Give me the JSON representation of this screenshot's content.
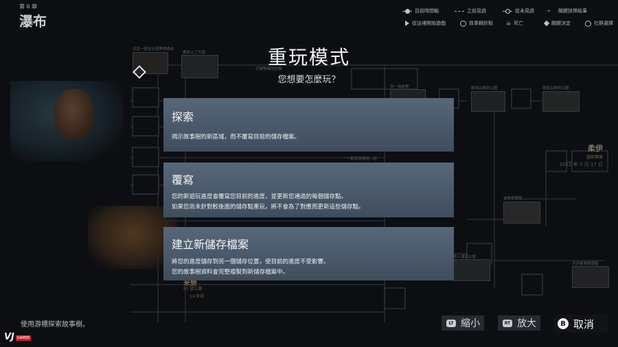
{
  "chapter": {
    "number": "第 6 章",
    "title": "瀑布"
  },
  "legend": [
    {
      "icon": "line-icon",
      "label": "目前時間軸"
    },
    {
      "icon": "dashed-line-icon",
      "label": "之前見過"
    },
    {
      "icon": "hollow-dot-icon",
      "label": "從未見過"
    },
    {
      "icon": "arrows-icon",
      "label": "關鍵抉擇結果"
    },
    {
      "icon": "play-icon",
      "label": "從這裡開始遊戲"
    },
    {
      "icon": "branch-icon",
      "label": "故事轉折點"
    },
    {
      "icon": "skull-icon",
      "label": "死亡"
    },
    {
      "icon": "key-decision-icon",
      "label": "關鍵決定"
    },
    {
      "icon": "community-icon",
      "label": "社群選擇"
    }
  ],
  "character": {
    "name": "柔伊",
    "role": "當前專案",
    "date": "2012 年 3 月 17 日"
  },
  "character2": {
    "name": "米勞",
    "line1": "83 號公路",
    "line2": "14 年前"
  },
  "tree_labels": {
    "t1": "泛克一家在分家夢想森布",
    "t2": "柔伊上了大學",
    "t3": "打破慣風的記錄",
    "t4": "另一場昂夢",
    "t5": "戰場古殿的公窟",
    "t6": "搜尋古殿的公窟",
    "t7": "一起到洞邊過…近",
    "t8": "被警察跟蹤",
    "t9": "他人漂流公窟",
    "t10": "杰伊被警察跟蹤"
  },
  "modal": {
    "title": "重玩模式",
    "subtitle": "您想要怎麼玩？",
    "options": [
      {
        "title": "探索",
        "lines": [
          "揭示故事樹的新區域，而不覆寫目前的儲存檔案。"
        ]
      },
      {
        "title": "覆寫",
        "lines": [
          "您的新遊玩進度會覆寫您目前的進度，並更新您通過的每個儲存點。",
          "如果您尚未針對較後面的儲存點重玩，將不會為了對應而更新這些儲存點。"
        ]
      },
      {
        "title": "建立新儲存檔案",
        "lines": [
          "將您的進度儲存到另一個儲存位置，使目前的進度不受影響。",
          "您的故事樹資料會完整複製到新儲存檔案中。"
        ]
      }
    ]
  },
  "footer": {
    "hint": "使用游標探索故事樹。",
    "zoom_out": {
      "key": "LT",
      "label": "縮小"
    },
    "zoom_in": {
      "key": "RT",
      "label": "放大"
    },
    "cancel": {
      "key": "B",
      "label": "取消"
    }
  },
  "watermark": {
    "main": "VJ",
    "tag": "GAMER"
  }
}
